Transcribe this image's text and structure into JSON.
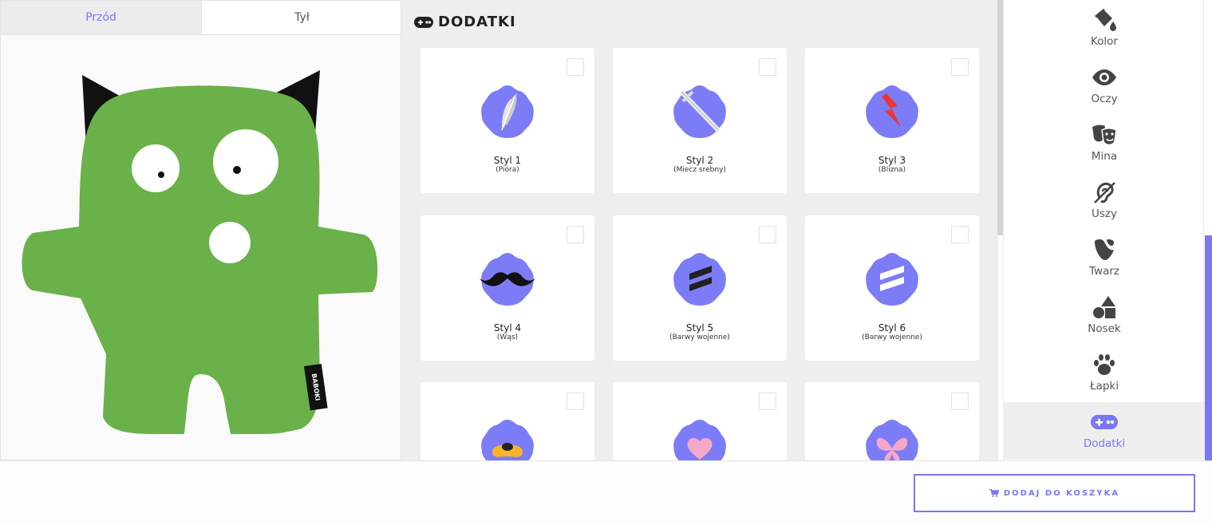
{
  "tabs": {
    "front": "Przód",
    "back": "Tył"
  },
  "preview": {
    "tag_text": "BABOKI",
    "body_color": "#6ab14a"
  },
  "addons": {
    "title": "DODATKI",
    "items": [
      {
        "name": "Styl 1",
        "sub": "(Pióra)",
        "icon": "feather-icon"
      },
      {
        "name": "Styl 2",
        "sub": "(Miecz srebny)",
        "icon": "sword-icon"
      },
      {
        "name": "Styl 3",
        "sub": "(Blizna)",
        "icon": "scar-icon"
      },
      {
        "name": "Styl 4",
        "sub": "(Wąs)",
        "icon": "mustache-icon"
      },
      {
        "name": "Styl 5",
        "sub": "(Barwy wojenne)",
        "icon": "warpaint-dark-icon"
      },
      {
        "name": "Styl 6",
        "sub": "(Barwy wojenne)",
        "icon": "warpaint-white-icon"
      },
      {
        "name": "",
        "sub": "",
        "icon": "pacifier-icon"
      },
      {
        "name": "",
        "sub": "",
        "icon": "heart-icon"
      },
      {
        "name": "",
        "sub": "",
        "icon": "butterfly-icon"
      }
    ]
  },
  "sidebar": {
    "items": [
      {
        "label": "Kolor",
        "icon": "paint-bucket-icon"
      },
      {
        "label": "Oczy",
        "icon": "eye-icon"
      },
      {
        "label": "Mina",
        "icon": "theater-masks-icon"
      },
      {
        "label": "Uszy",
        "icon": "deaf-ear-icon"
      },
      {
        "label": "Twarz",
        "icon": "typo3-face-icon"
      },
      {
        "label": "Nosek",
        "icon": "shapes-icon"
      },
      {
        "label": "Łapki",
        "icon": "paw-icon"
      },
      {
        "label": "Dodatki",
        "icon": "gamepad-icon"
      }
    ],
    "active": "Dodatki"
  },
  "cart": {
    "label": "DODAJ DO KOSZYKA",
    "icon": "cart-icon"
  },
  "colors": {
    "accent": "#7a78f0",
    "badge": "#7d7cf7",
    "monster_green": "#6ab14a"
  }
}
